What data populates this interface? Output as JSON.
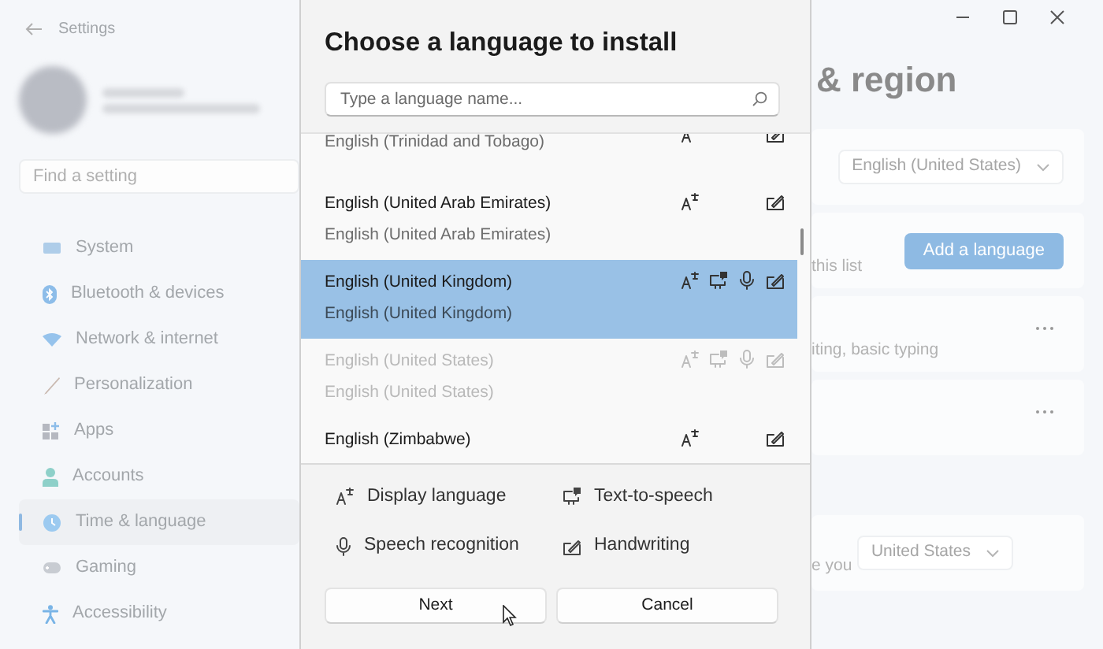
{
  "settings": {
    "title": "Settings",
    "search": {
      "placeholder": "Find a setting"
    },
    "nav": [
      {
        "label": "System",
        "selected": false
      },
      {
        "label": "Bluetooth & devices",
        "selected": false
      },
      {
        "label": "Network & internet",
        "selected": false
      },
      {
        "label": "Personalization",
        "selected": false
      },
      {
        "label": "Apps",
        "selected": false
      },
      {
        "label": "Accounts",
        "selected": false
      },
      {
        "label": "Time & language",
        "selected": true
      },
      {
        "label": "Gaming",
        "selected": false
      },
      {
        "label": "Accessibility",
        "selected": false
      }
    ]
  },
  "content": {
    "heading": "& region",
    "cards": [
      {
        "kind": "dropdown",
        "value": "English (United States)"
      },
      {
        "kind": "action",
        "text": "this list",
        "button": "Add a language"
      },
      {
        "kind": "more",
        "text": "iting, basic typing"
      },
      {
        "kind": "more"
      }
    ],
    "region_card": {
      "text": "e you",
      "value": "United States"
    }
  },
  "dialog": {
    "title": "Choose a language to install",
    "search": {
      "placeholder": "Type a language name..."
    },
    "languages": [
      {
        "secondary": "English (Trinidad and Tobago)",
        "display_language": true,
        "text_to_speech": false,
        "speech_recognition": false,
        "handwriting": true,
        "selected": false,
        "disabled": false
      },
      {
        "name": "English (United Arab Emirates)",
        "secondary": "English (United Arab Emirates)",
        "display_language": true,
        "text_to_speech": false,
        "speech_recognition": false,
        "handwriting": true,
        "selected": false,
        "disabled": false
      },
      {
        "name": "English (United Kingdom)",
        "secondary": "English (United Kingdom)",
        "display_language": true,
        "text_to_speech": true,
        "speech_recognition": true,
        "handwriting": true,
        "selected": true,
        "disabled": false
      },
      {
        "name": "English (United States)",
        "secondary": "English (United States)",
        "display_language": true,
        "text_to_speech": true,
        "speech_recognition": true,
        "handwriting": true,
        "selected": false,
        "disabled": true
      },
      {
        "name": "English (Zimbabwe)",
        "display_language": true,
        "text_to_speech": false,
        "speech_recognition": false,
        "handwriting": true,
        "selected": false,
        "disabled": false
      }
    ],
    "legend": [
      {
        "kind": "display_language",
        "label": "Display language"
      },
      {
        "kind": "text_to_speech",
        "label": "Text-to-speech"
      },
      {
        "kind": "speech_recognition",
        "label": "Speech recognition"
      },
      {
        "kind": "handwriting",
        "label": "Handwriting"
      }
    ],
    "buttons": [
      "Next",
      "Cancel"
    ]
  }
}
